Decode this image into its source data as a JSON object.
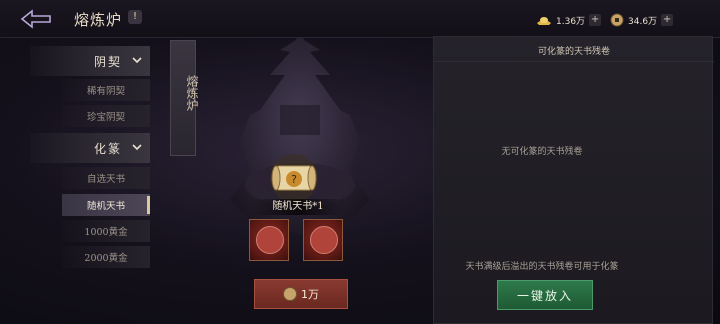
{
  "header": {
    "title": "熔炼炉",
    "info_label": "!"
  },
  "resources": [
    {
      "name": "gold-ingot",
      "value": "1.36万",
      "plus": "+"
    },
    {
      "name": "coin",
      "value": "34.6万",
      "plus": "+"
    }
  ],
  "sidebar": {
    "categories": [
      {
        "label": "阴契",
        "items": [
          "稀有阴契",
          "珍宝阴契"
        ]
      },
      {
        "label": "化篆",
        "items": [
          "自选天书",
          "随机天书",
          "1000黄金",
          "2000黄金"
        ]
      }
    ],
    "active_item": "随机天书"
  },
  "furnace": {
    "vertical_label": "熔炼炉",
    "item_label": "随机天书*1",
    "cost_value": "1万"
  },
  "panel": {
    "title": "可化篆的天书残卷",
    "empty_message": "无可化篆的天书残卷",
    "note": "天书满级后溢出的天书残卷可用于化篆",
    "action_label": "一键放入"
  },
  "colors": {
    "accent_gold": "#d9c9a0",
    "action_green": "#2e7a4a",
    "cost_red": "#8a3a30"
  }
}
